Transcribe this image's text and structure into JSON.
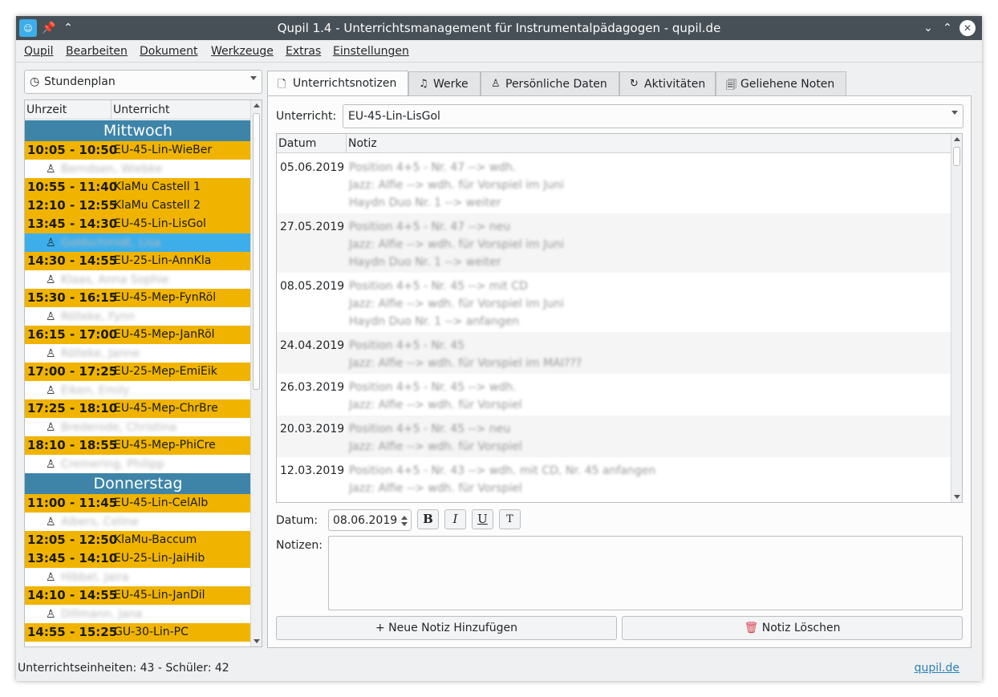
{
  "window": {
    "title": "Qupil 1.4 - Unterrichtsmanagement für Instrumentalpädagogen - qupil.de",
    "pin_glyph": "📌",
    "collapse_glyph": "⌃",
    "minimize_glyph": "⌄",
    "maximize_glyph": "⌃",
    "close_glyph": "✕"
  },
  "menu": [
    "Qupil",
    "Bearbeiten",
    "Dokument",
    "Werkzeuge",
    "Extras",
    "Einstellungen"
  ],
  "view_select": {
    "icon": "clock-icon",
    "glyph": "◷",
    "value": "Stundenplan"
  },
  "schedule": {
    "headers": [
      "Uhrzeit",
      "Unterricht"
    ],
    "person_glyph": "♙",
    "rows": [
      {
        "type": "day",
        "label": "Mittwoch"
      },
      {
        "type": "lesson",
        "time": "10:05 - 10:50",
        "name": "EU-45-Lin-WieBer"
      },
      {
        "type": "student",
        "name": "Berndsen, Wiebke"
      },
      {
        "type": "lesson",
        "time": "10:55 - 11:40",
        "name": "KlaMu Castell 1"
      },
      {
        "type": "lesson",
        "time": "12:10 - 12:55",
        "name": "KlaMu Castell 2"
      },
      {
        "type": "lesson",
        "time": "13:45 - 14:30",
        "name": "EU-45-Lin-LisGol"
      },
      {
        "type": "student",
        "name": "Goldschmidt, Lisa",
        "selected": true
      },
      {
        "type": "lesson",
        "time": "14:30 - 14:55",
        "name": "EU-25-Lin-AnnKla"
      },
      {
        "type": "student",
        "name": "Klaas, Anna Sophie"
      },
      {
        "type": "lesson",
        "time": "15:30 - 16:15",
        "name": "EU-45-Mep-FynRöl"
      },
      {
        "type": "student",
        "name": "Rölleke, Fynn"
      },
      {
        "type": "lesson",
        "time": "16:15 - 17:00",
        "name": "EU-45-Mep-JanRöl"
      },
      {
        "type": "student",
        "name": "Rölleke, Janne"
      },
      {
        "type": "lesson",
        "time": "17:00 - 17:25",
        "name": "EU-25-Mep-EmiEik"
      },
      {
        "type": "student",
        "name": "Eiken, Emily"
      },
      {
        "type": "lesson",
        "time": "17:25 - 18:10",
        "name": "EU-45-Mep-ChrBre"
      },
      {
        "type": "student",
        "name": "Brederode, Christina"
      },
      {
        "type": "lesson",
        "time": "18:10 - 18:55",
        "name": "EU-45-Mep-PhiCre"
      },
      {
        "type": "student",
        "name": "Cremering, Philipp"
      },
      {
        "type": "day",
        "label": "Donnerstag"
      },
      {
        "type": "lesson",
        "time": "11:00 - 11:45",
        "name": "EU-45-Lin-CelAlb"
      },
      {
        "type": "student",
        "name": "Albers, Celine"
      },
      {
        "type": "lesson",
        "time": "12:05 - 12:50",
        "name": "KlaMu-Baccum"
      },
      {
        "type": "lesson",
        "time": "13:45 - 14:10",
        "name": "EU-25-Lin-JaiHib"
      },
      {
        "type": "student",
        "name": "Hibbel, Jaira"
      },
      {
        "type": "lesson",
        "time": "14:10 - 14:55",
        "name": "EU-45-Lin-JanDil"
      },
      {
        "type": "student",
        "name": "Dillmann, Jana"
      },
      {
        "type": "lesson",
        "time": "14:55 - 15:25",
        "name": "GU-30-Lin-PC"
      }
    ]
  },
  "tabs": [
    {
      "label": "Unterrichtsnotizen",
      "icon": "note-icon",
      "glyph": "🗋",
      "active": true
    },
    {
      "label": "Werke",
      "icon": "music-note-icon",
      "glyph": "♫"
    },
    {
      "label": "Persönliche Daten",
      "icon": "person-icon",
      "glyph": "♙"
    },
    {
      "label": "Aktivitäten",
      "icon": "refresh-icon",
      "glyph": "↻"
    },
    {
      "label": "Geliehene Noten",
      "icon": "document-icon",
      "glyph": "🗐"
    }
  ],
  "lesson_select": {
    "label": "Unterricht:",
    "value": "EU-45-Lin-LisGol"
  },
  "notes_table": {
    "headers": [
      "Datum",
      "Notiz"
    ],
    "rows": [
      {
        "date": "05.06.2019",
        "lines": [
          "Position 4+5 - Nr. 47 --> wdh.",
          "Jazz: Alfie --> wdh. für Vorspiel im Juni",
          "Haydn Duo Nr. 1 --> weiter"
        ]
      },
      {
        "date": "27.05.2019",
        "lines": [
          "Position 4+5 - Nr. 47 --> neu",
          "Jazz: Alfie --> wdh. für Vorspiel im Juni",
          "Haydn Duo Nr. 1 --> weiter"
        ]
      },
      {
        "date": "08.05.2019",
        "lines": [
          "Position 4+5 - Nr. 45 --> mit CD",
          "Jazz: Alfie --> wdh. für Vorspiel im Juni",
          "Haydn Duo Nr. 1 --> anfangen"
        ]
      },
      {
        "date": "24.04.2019",
        "lines": [
          "Position 4+5 - Nr. 45",
          "Jazz: Alfie --> wdh. für Vorspiel im MAI???"
        ]
      },
      {
        "date": "26.03.2019",
        "lines": [
          "Position 4+5 - Nr. 45 --> wdh.",
          "Jazz: Alfie --> wdh. für Vorspiel"
        ]
      },
      {
        "date": "20.03.2019",
        "lines": [
          "Position 4+5 - Nr. 45 --> neu",
          "Jazz: Alfie --> wdh. für Vorspiel"
        ]
      },
      {
        "date": "12.03.2019",
        "lines": [
          "Position 4+5 - Nr. 43 --> wdh. mit CD, Nr. 45 anfangen",
          "Jazz: Alfie --> wdh. für Vorspiel"
        ]
      }
    ]
  },
  "editor": {
    "date_label": "Datum:",
    "date_value": "08.06.2019",
    "bold": "B",
    "italic": "I",
    "underline": "U",
    "clear_format": "T",
    "notes_label": "Notizen:",
    "add_button": "+ Neue Notiz Hinzufügen",
    "delete_glyph": "🗑",
    "delete_button": "Notiz Löschen"
  },
  "status": {
    "text": "Unterrichtseinheiten: 43 - Schüler: 42",
    "link": "qupil.de"
  },
  "colors": {
    "day_header": "#3d84a8",
    "lesson_row": "#f0b400",
    "selection": "#3daee9",
    "titlebar": "#475057"
  }
}
